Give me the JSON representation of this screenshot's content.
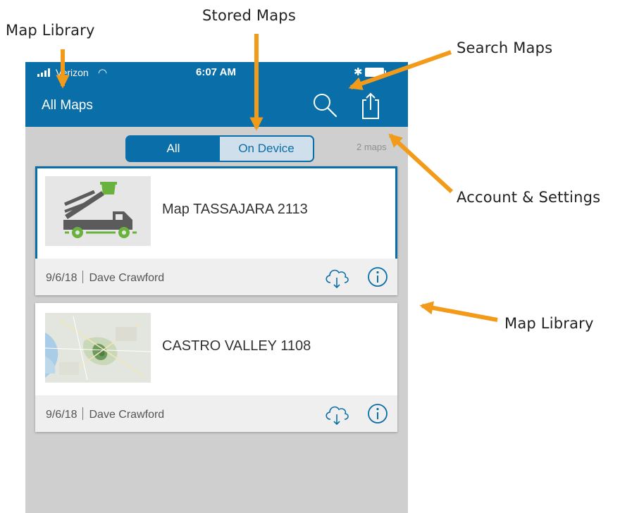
{
  "callouts": {
    "map_library_top": "Map Library",
    "stored_maps": "Stored Maps",
    "search_maps": "Search  Maps",
    "account_settings": "Account & Settings",
    "map_library_right": "Map Library"
  },
  "status_bar": {
    "carrier": "Verizon",
    "time": "6:07 AM"
  },
  "nav": {
    "title": "All Maps",
    "icons": [
      "search-icon",
      "share-icon"
    ]
  },
  "filter": {
    "options": [
      "All",
      "On Device"
    ],
    "selected": "On Device",
    "count": "2 maps"
  },
  "maps": [
    {
      "title": "Map TASSAJARA 2113",
      "date": "9/6/18",
      "author": "Dave Crawford",
      "thumbnail": "truck-icon",
      "selected": true
    },
    {
      "title": "CASTRO VALLEY 1108",
      "date": "9/6/18",
      "author": "Dave Crawford",
      "thumbnail": "map-thumbnail",
      "selected": false
    }
  ],
  "colors": {
    "navbar": "#0a6ea8",
    "arrow": "#f29b1a",
    "background": "#cfcfcf"
  }
}
